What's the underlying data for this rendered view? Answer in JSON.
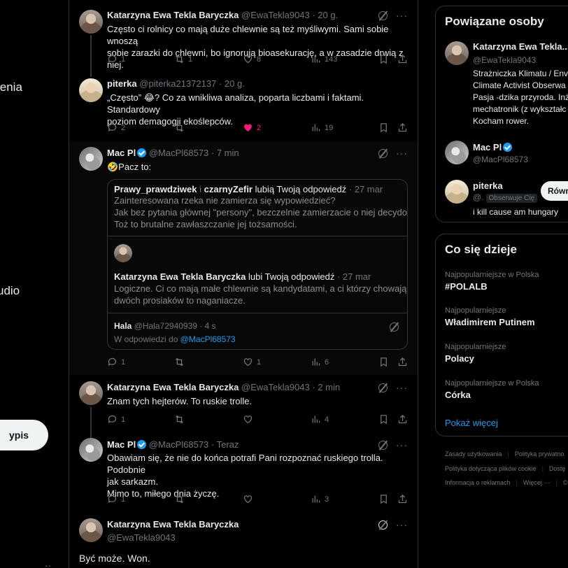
{
  "left_nav": {
    "items": [
      {
        "label": "ienia"
      },
      {
        "label": "udio"
      }
    ],
    "post_button": "ypis",
    "more": "··"
  },
  "thread": [
    {
      "author": "Katarzyna Ewa Tekla Baryczka",
      "handle": "@EwaTekla9043 · 20 g.",
      "lines": [
        "Często ci rolnicy co mają duże chlewnie są też myśliwymi. Sami sobie wnoszą",
        "sobie zarazki do chlewni, bo ignorują bioasekurację, a w zasadzie drwią z niej."
      ],
      "replies": "1",
      "reposts": "1",
      "likes": "8",
      "views": "143"
    },
    {
      "author": "piterka",
      "handle": "@piterka21372137 · 20 g.",
      "lines": [
        "„Często” 😂? Co za wnikliwa analiza, poparta liczbami i faktami. Standardowy",
        "poziom demagogii ekoślepców."
      ],
      "replies": "2",
      "reposts": "",
      "likes": "2",
      "views": "19"
    },
    {
      "author": "Mac Pl",
      "handle": "@MacPl68573 · 7 min",
      "lines": [
        "🤣Pacz to:"
      ],
      "replies": "1",
      "reposts": "",
      "likes": "1",
      "views": "6",
      "quote": {
        "notice1_a": "Prawy_prawdziwek",
        "notice1_b": " i ",
        "notice1_c": "czarnyZefir",
        "notice1_d": " lubią Twoją odpowiedź",
        "notice1_time": " · 27 mar",
        "text1": [
          "Zainteresowana rzeka nie zamierza się wypowiedzieć?",
          "Jak bez pytania głównej \"persony\", bezczelnie zamierzacie o niej decydować?",
          "Toż to brutalne zawłaszczanie jej tożsamości."
        ],
        "notice2_a": "Katarzyna Ewa Tekla Baryczka",
        "notice2_b": " lubi Twoją odpowiedź",
        "notice2_time": " · 27 mar",
        "text2": [
          "Logiczne. Ci co mają małe chlewnie są kandydatami, a ci którzy chowają do",
          "dwóch prosiaków to naganiacze."
        ],
        "hala_name": "Hala",
        "hala_handle": " @Hala72940939 · 4 s",
        "reply_to": "W odpowiedzi do ",
        "reply_mention": "@MacPl68573"
      }
    },
    {
      "author": "Katarzyna Ewa Tekla Baryczka",
      "handle": "@EwaTekla9043 · 2 min",
      "lines": [
        "Znam tych hejterów. To ruskie trolle."
      ],
      "replies": "1",
      "reposts": "",
      "likes": "",
      "views": "4"
    },
    {
      "author": "Mac Pl",
      "handle": "@MacPl68573 · Teraz",
      "lines": [
        "Obawiam się, że nie do końca potrafi Pani rozpoznać ruskiego trolla. Podobnie",
        "jak sarkazm.",
        "Mimo to, miłego dnia życzę."
      ],
      "replies": "1",
      "reposts": "",
      "likes": "",
      "views": "3"
    },
    {
      "author": "Katarzyna Ewa Tekla Baryczka",
      "handle": "@EwaTekla9043",
      "lines": [
        "Być może. Won."
      ]
    }
  ],
  "related": {
    "title": "Powiązane osoby",
    "people": [
      {
        "name": "Katarzyna Ewa Tekla...",
        "handle": "@EwaTekla9043",
        "bio": [
          "Strażniczka Klimatu / Env",
          "Climate Activist Obserwa",
          "Pasja -dzika przyroda. Inż",
          "mechatronik (z wykształc",
          "Kocham rower."
        ]
      },
      {
        "name": "Mac Pl",
        "handle": "@MacPl68573"
      },
      {
        "name": "piterka",
        "handle": "@.",
        "follows_you": "Obserwuje Cię",
        "follow_button": "Równ",
        "bio": [
          "i kill cause am hungary"
        ]
      }
    ]
  },
  "trends": {
    "title": "Co się dzieje",
    "items": [
      {
        "category": "Najpopularniejsze w Polska",
        "name": "#POLALB"
      },
      {
        "category": "Najpopularniejsze",
        "name": "Władimirem Putinem"
      },
      {
        "category": "Najpopularniejsze",
        "name": "Polacy"
      },
      {
        "category": "Najpopularniejsze w Polska",
        "name": "Córka"
      }
    ],
    "show_more": "Pokaż więcej"
  },
  "footer": {
    "row1": [
      "Zasady użytkowania",
      "Polityka prywatno"
    ],
    "row2": [
      "Polityka dotycząca plików cookie",
      "Dostę"
    ],
    "row3": [
      "Informacja o reklamach",
      "Więcej ···",
      "© 2"
    ]
  }
}
